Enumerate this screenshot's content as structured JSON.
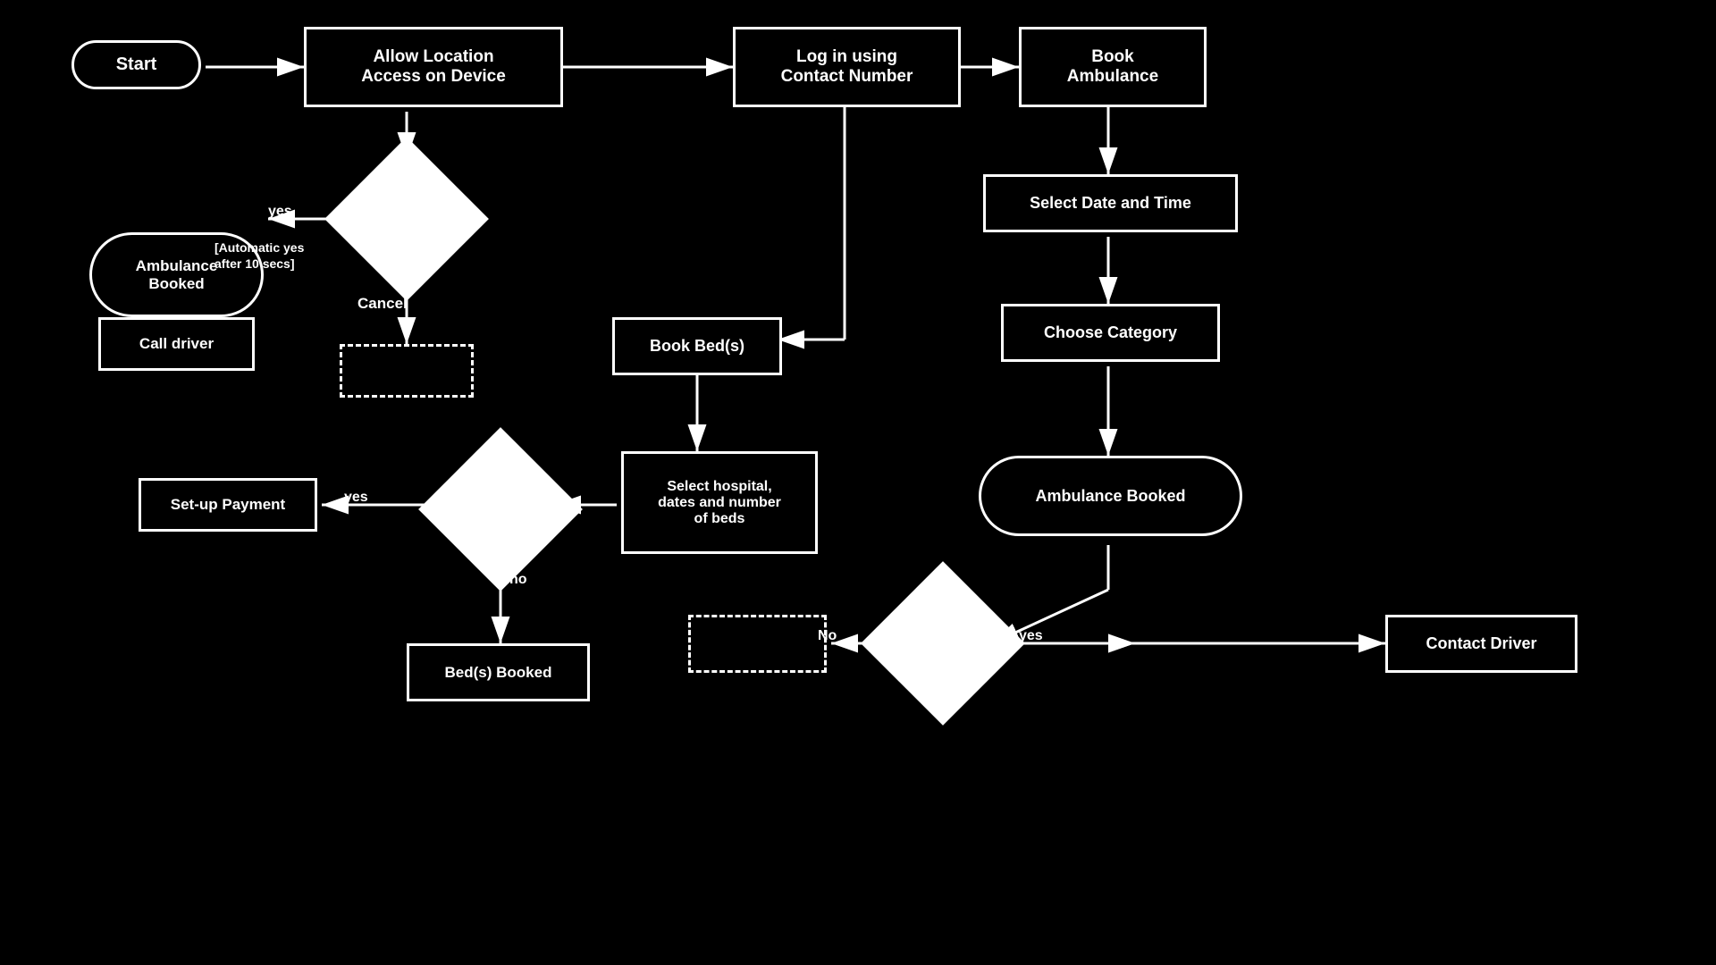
{
  "nodes": {
    "start": {
      "label": "Start"
    },
    "allow_location": {
      "label": "Allow Location\nAccess on Device"
    },
    "log_in": {
      "label": "Log in using\nContact Number"
    },
    "book_ambulance": {
      "label": "Book\nAmbulance"
    },
    "select_date": {
      "label": "Select Date and Time"
    },
    "choose_category": {
      "label": "Choose Category"
    },
    "ambulance_booked_right": {
      "label": "Ambulance Booked"
    },
    "ambulance_booked_left": {
      "label": "Ambulance\nBooked"
    },
    "call_driver": {
      "label": "Call driver"
    },
    "book_beds": {
      "label": "Book Bed(s)"
    },
    "select_hospital": {
      "label": "Select hospital,\ndates and number\nof beds"
    },
    "setup_payment": {
      "label": "Set-up Payment"
    },
    "beds_booked": {
      "label": "Bed(s) Booked"
    },
    "contact_driver": {
      "label": "Contact Driver"
    },
    "cancel_label": {
      "label": "Cancel"
    },
    "yes_label_1": {
      "label": "yes"
    },
    "auto_yes_label": {
      "label": "[Automatic yes\nafter 10 secs]"
    },
    "yes_label_2": {
      "label": "yes"
    },
    "no_label": {
      "label": "no"
    },
    "no_label_2": {
      "label": "No"
    },
    "yes_label_3": {
      "label": "yes"
    }
  },
  "colors": {
    "background": "#000000",
    "node_bg": "#000000",
    "node_border": "#ffffff",
    "text": "#ffffff",
    "diamond_fill": "#ffffff",
    "arrow": "#ffffff"
  }
}
